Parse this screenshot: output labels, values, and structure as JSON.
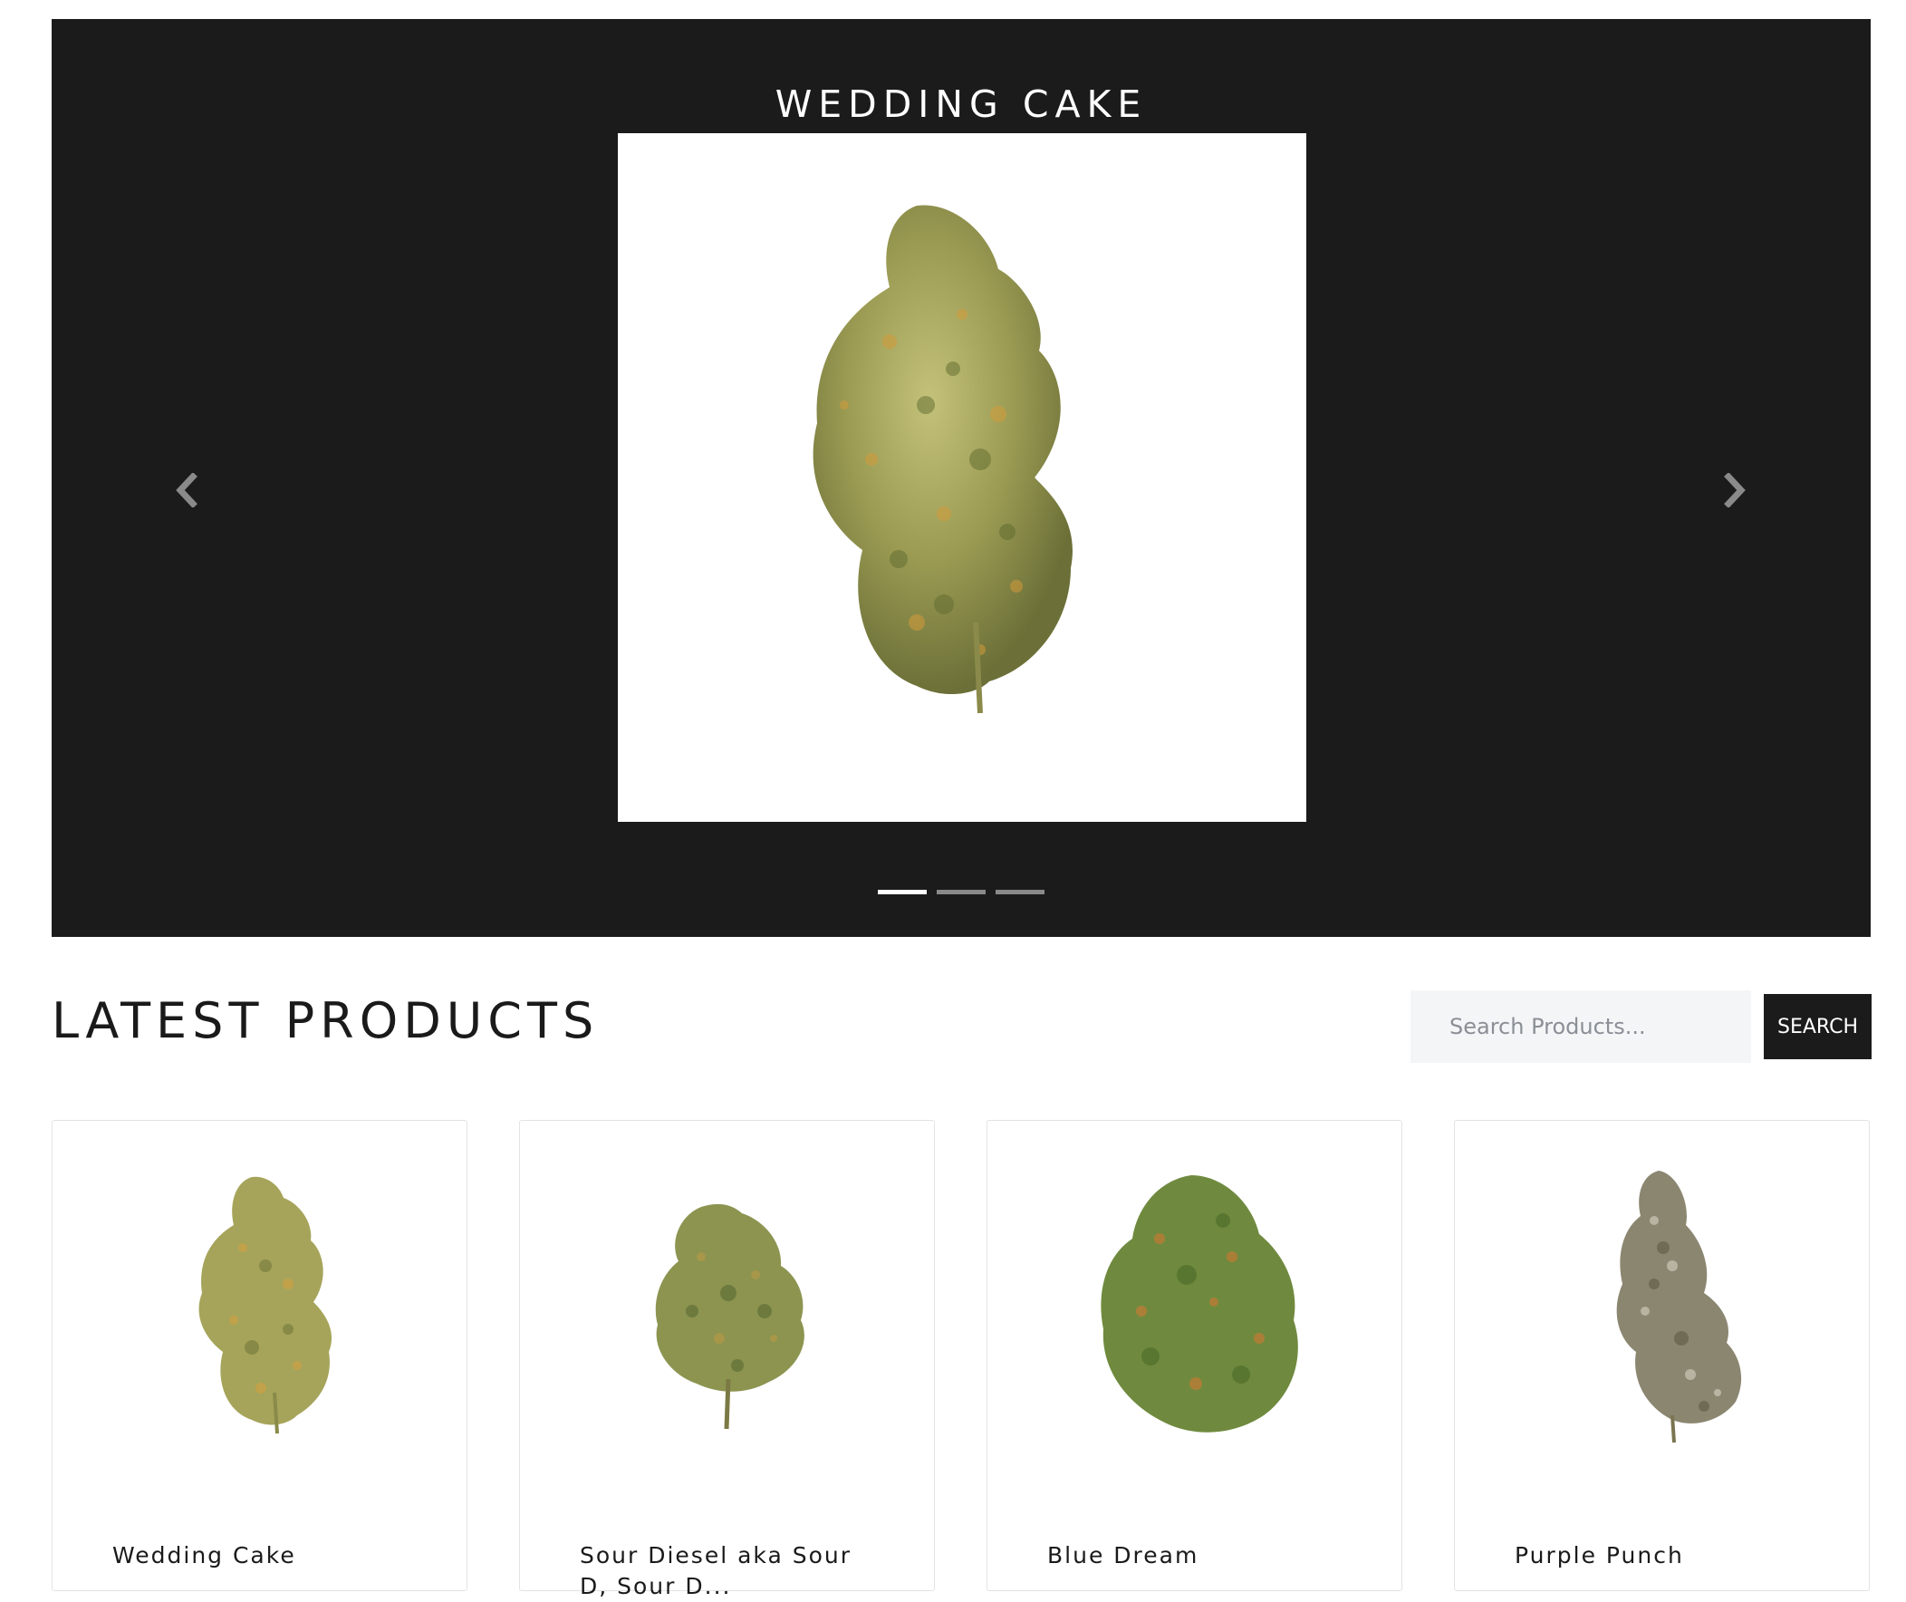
{
  "hero": {
    "title": "WEDDING CAKE",
    "slide_image": "cannabis-bud-wedding-cake",
    "prev_icon": "chevron-left-icon",
    "next_icon": "chevron-right-icon",
    "indicators": [
      {
        "active": true
      },
      {
        "active": false
      },
      {
        "active": false
      }
    ]
  },
  "section": {
    "title": "LATEST PRODUCTS"
  },
  "search": {
    "placeholder": "Search Products...",
    "button_label": "SEARCH"
  },
  "products": [
    {
      "name": "Wedding Cake",
      "image": "wedding-cake-bud"
    },
    {
      "name": "Sour Diesel aka Sour D, Sour D...",
      "image": "sour-diesel-bud"
    },
    {
      "name": "Blue Dream",
      "image": "blue-dream-bud"
    },
    {
      "name": "Purple Punch",
      "image": "purple-punch-bud"
    }
  ],
  "colors": {
    "hero_bg": "#1b1b1c",
    "button_bg": "#1b1b1c",
    "indicator_active": "#ffffff",
    "indicator_inactive": "#8a8a8a",
    "search_bg": "#f4f5f7"
  }
}
